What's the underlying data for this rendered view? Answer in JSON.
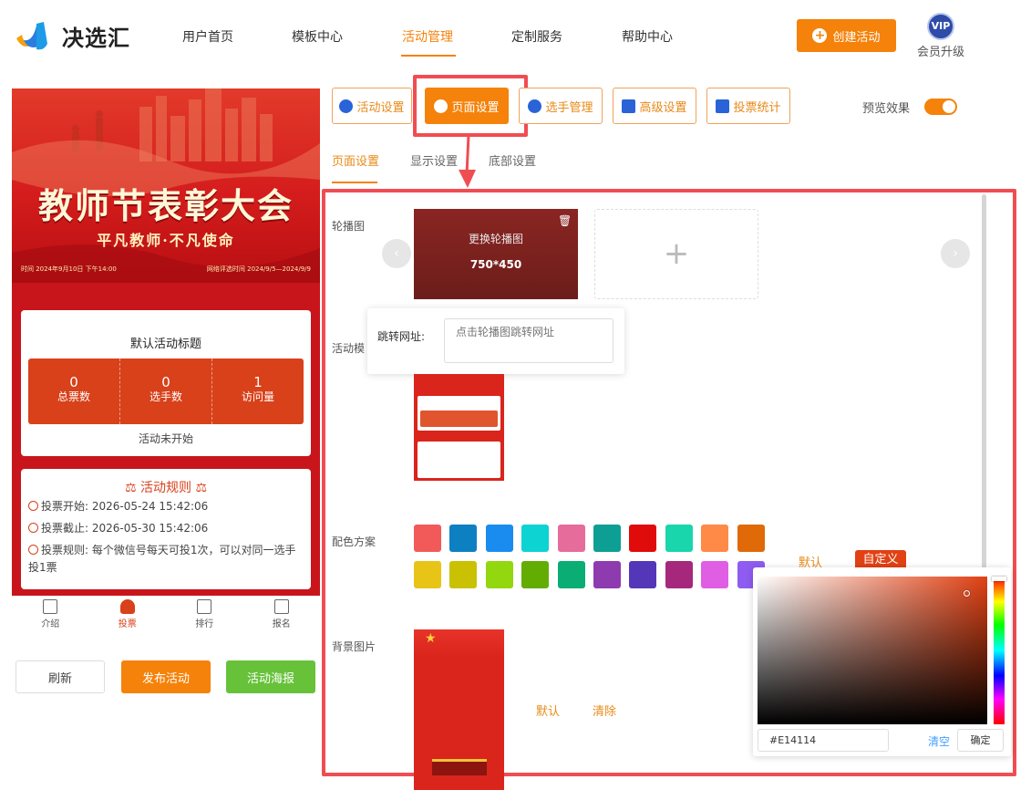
{
  "brand": {
    "name": "决选汇"
  },
  "nav": {
    "items": [
      "用户首页",
      "模板中心",
      "活动管理",
      "定制服务",
      "帮助中心"
    ],
    "create_label": "创建活动",
    "vip_badge": "VIP",
    "vip_label": "会员升级"
  },
  "preview": {
    "banner_title": "教师节表彰大会",
    "banner_subtitle": "平凡教师·不凡使命",
    "banner_time": "时间  2024年9月10日 下午14:00",
    "banner_vote_time": "网络评选时间  2024/9/5—2024/9/9",
    "activity_title": "默认活动标题",
    "stats": [
      {
        "value": "0",
        "label": "总票数"
      },
      {
        "value": "0",
        "label": "选手数"
      },
      {
        "value": "1",
        "label": "访问量"
      }
    ],
    "status": "活动未开始",
    "rules_title": "活动规则",
    "rules": [
      "投票开始:  2026-05-24 15:42:06",
      "投票截止:  2026-05-30 15:42:06",
      "投票规则:  每个微信号每天可投1次，可以对同一选手投1票"
    ],
    "tabs": [
      "介绍",
      "投票",
      "排行",
      "报名"
    ],
    "active_tab": "投票"
  },
  "actions": {
    "refresh": "刷新",
    "publish": "发布活动",
    "poster": "活动海报"
  },
  "toolbar": {
    "buttons": [
      "活动设置",
      "页面设置",
      "选手管理",
      "高级设置",
      "投票统计"
    ],
    "active": "页面设置",
    "preview_label": "预览效果",
    "preview_on": true
  },
  "subtabs": {
    "items": [
      "页面设置",
      "显示设置",
      "底部设置"
    ],
    "active": "页面设置"
  },
  "carousel": {
    "label": "轮播图",
    "replace_text": "更换轮播图",
    "size_text": "750*450",
    "link_label": "跳转网址:",
    "link_placeholder": "点击轮播图跳转网址"
  },
  "template": {
    "label": "活动模"
  },
  "color_scheme": {
    "label": "配色方案",
    "swatches": [
      "#f25a5a",
      "#0d80c2",
      "#1a8cf0",
      "#0dd3d3",
      "#e56c9b",
      "#0d9f94",
      "#e00b0b",
      "#19d6ac",
      "#ff8946",
      "#e06a07",
      "#e8c417",
      "#c9c102",
      "#93d70e",
      "#63ad03",
      "#0aad74",
      "#8f3bb0",
      "#5437b8",
      "#a5287c",
      "#e05ee3",
      "#8e5cf0"
    ],
    "default_label": "默认",
    "custom_label": "自定义"
  },
  "background": {
    "label": "背景图片",
    "default_label": "默认",
    "clear_label": "清除"
  },
  "color_picker": {
    "hex_value": "#E14114",
    "clear_label": "清空",
    "confirm_label": "确定",
    "hue_color": "#e14114"
  },
  "colors": {
    "accent": "#f5820a",
    "highlight": "#f04d52",
    "theme_red": "#d8411a"
  }
}
